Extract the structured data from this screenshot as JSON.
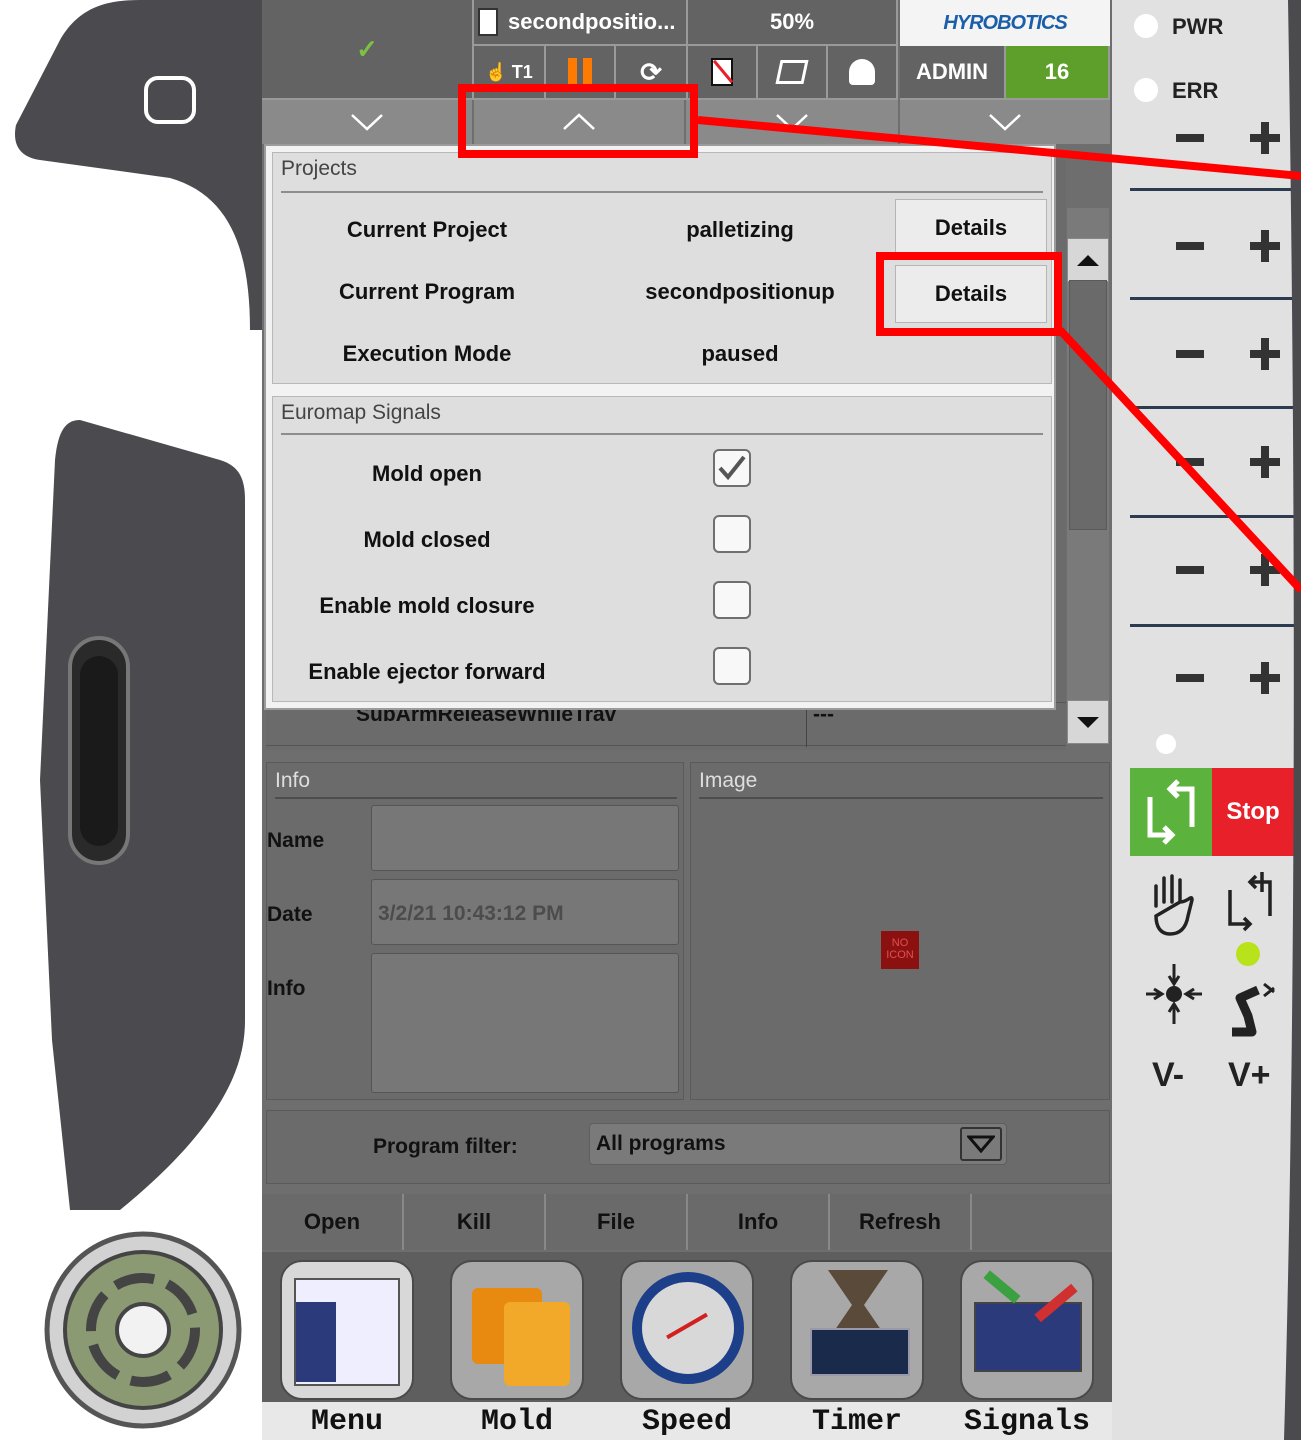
{
  "status_bar": {
    "program_name": "secondpositio...",
    "speed": "50%",
    "brand": "HYROBOTICS",
    "user": "ADMIN",
    "level": "16",
    "mode": "T1"
  },
  "projects": {
    "title": "Projects",
    "rows": [
      {
        "label": "Current Project",
        "value": "palletizing",
        "button": "Details"
      },
      {
        "label": "Current Program",
        "value": "secondpositionup",
        "button": "Details"
      },
      {
        "label": "Execution Mode",
        "value": "paused"
      }
    ]
  },
  "euromap": {
    "title": "Euromap Signals",
    "signals": [
      {
        "label": "Mold open",
        "checked": true
      },
      {
        "label": "Mold closed",
        "checked": false
      },
      {
        "label": "Enable mold closure",
        "checked": false
      },
      {
        "label": "Enable ejector forward",
        "checked": false
      }
    ]
  },
  "background_list": {
    "row_name": "SubArmReleaseWhileTrav",
    "row_value": "---"
  },
  "info_panel": {
    "title": "Info",
    "name_label": "Name",
    "name_value": "",
    "date_label": "Date",
    "date_value": "3/2/21 10:43:12 PM",
    "info_label": "Info",
    "info_value": ""
  },
  "image_panel": {
    "title": "Image",
    "placeholder": "NO ICON"
  },
  "filter": {
    "label": "Program filter:",
    "value": "All programs"
  },
  "actions": [
    "Open",
    "Kill",
    "File",
    "Info",
    "Refresh"
  ],
  "nav": [
    "Menu",
    "Mold",
    "Speed",
    "Timer",
    "Signals"
  ],
  "right_panel": {
    "pwr": "PWR",
    "err": "ERR",
    "stop": "Stop",
    "v_minus": "V-",
    "v_plus": "V+"
  },
  "colors": {
    "highlight": "#ff0000",
    "level_green": "#5e9e2a",
    "start_green": "#5bb23d",
    "stop_red": "#e8202a",
    "brand_blue": "#1b5fa8"
  }
}
